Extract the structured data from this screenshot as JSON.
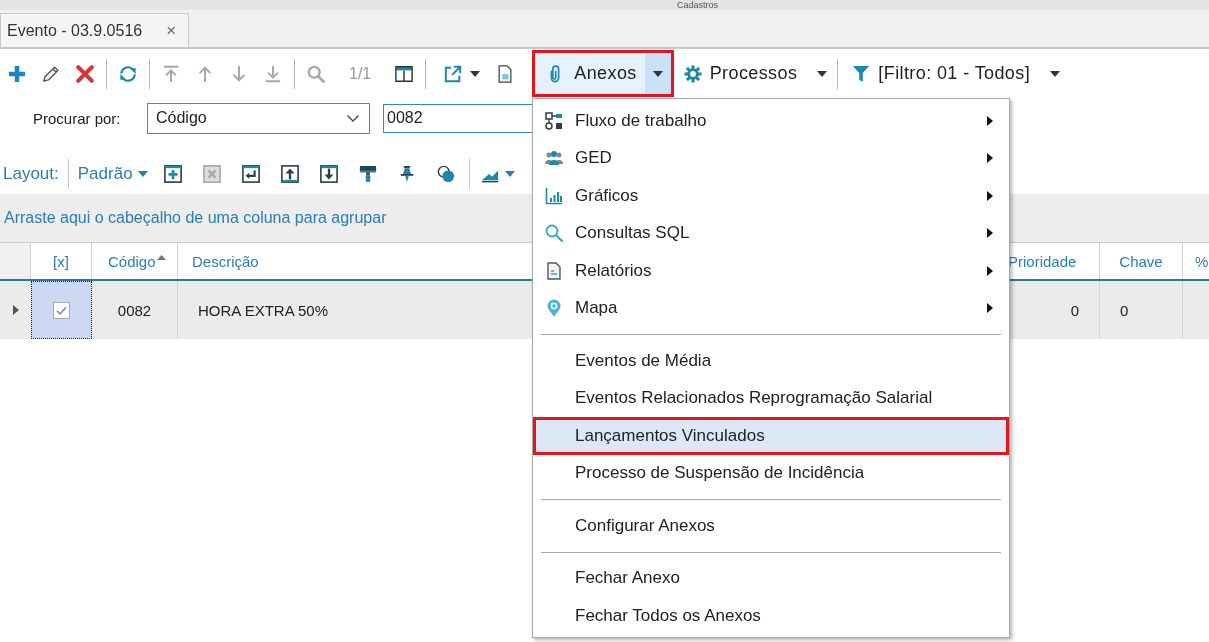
{
  "window": {
    "title": "Cadastros"
  },
  "tabs": [
    {
      "label": "Evento - 03.9.0516",
      "close": "×",
      "selected": true
    }
  ],
  "toolbar": {
    "groups": [
      {
        "items": [
          {
            "kind": "icon_button",
            "disabled": false
          },
          {
            "kind": "icon_button",
            "disabled": false
          },
          {
            "kind": "icon_button",
            "disabled": false
          }
        ]
      },
      {
        "items": [
          {
            "kind": "icon_button",
            "disabled": false
          }
        ]
      },
      {
        "items": [
          {
            "kind": "icon_button",
            "disabled": true
          },
          {
            "kind": "icon_button",
            "disabled": true
          },
          {
            "kind": "icon_button",
            "disabled": true
          },
          {
            "kind": "icon_button",
            "disabled": true
          }
        ]
      },
      {
        "items": [
          {
            "kind": "icon_button",
            "disabled": true
          },
          {
            "kind": "counter",
            "text": "1/1"
          },
          {
            "kind": "icon_button",
            "disabled": false
          }
        ]
      },
      {
        "items": [
          {
            "kind": "icon_dropdown"
          },
          {
            "kind": "icon_button",
            "disabled": false
          },
          {
            "kind": "split_button",
            "label": "Anexos",
            "expanded": true,
            "annotated": true
          },
          {
            "kind": "menu_button",
            "label": "Processos",
            "expanded": false,
            "annotated": false
          }
        ]
      },
      {
        "items": [
          {
            "kind": "menu_button",
            "label": "[Filtro: 01 - Todos]",
            "expanded": false,
            "annotated": false
          }
        ]
      }
    ]
  },
  "search": {
    "label": "Procurar por:",
    "field": {
      "value": "Código"
    },
    "query": {
      "value": "0082",
      "focused": true
    }
  },
  "layout_bar": {
    "label": "Layout:",
    "preset": "Padrão",
    "groups": [
      {
        "items": [
          {
            "kind": "icon_button",
            "disabled": false
          },
          {
            "kind": "icon_button",
            "disabled": true
          },
          {
            "kind": "icon_button",
            "disabled": false
          },
          {
            "kind": "icon_button",
            "disabled": false
          },
          {
            "kind": "icon_button",
            "disabled": false
          },
          {
            "kind": "icon_button",
            "disabled": false
          },
          {
            "kind": "icon_button",
            "disabled": false
          },
          {
            "kind": "icon_button",
            "disabled": false
          }
        ]
      },
      {
        "items": [
          {
            "kind": "icon_dropdown"
          }
        ]
      }
    ]
  },
  "grid": {
    "group_hint": "Arraste aqui o cabeçalho de uma coluna para agrupar",
    "columns": [
      {
        "label": "[x]",
        "sorted": false
      },
      {
        "label": "Código",
        "sorted": true
      },
      {
        "label": "Descrição",
        "sorted": false
      },
      {
        "label": "Prioridade",
        "sorted": false
      },
      {
        "label": "Chave",
        "sorted": false
      },
      {
        "label": "%",
        "sorted": false
      }
    ],
    "rows": [
      {
        "current": true,
        "checked": true,
        "cells": [
          "",
          "0082",
          "HORA EXTRA 50%",
          "0",
          "0"
        ]
      }
    ]
  },
  "menu": {
    "sections": [
      {
        "items": [
          {
            "label": "Fluxo de trabalho",
            "submenu": true,
            "selected": false,
            "annotated": false
          },
          {
            "label": "GED",
            "submenu": true,
            "selected": false,
            "annotated": false
          },
          {
            "label": "Gráficos",
            "submenu": true,
            "selected": false,
            "annotated": false
          },
          {
            "label": "Consultas SQL",
            "submenu": true,
            "selected": false,
            "annotated": false
          },
          {
            "label": "Relatórios",
            "submenu": true,
            "selected": false,
            "annotated": false
          },
          {
            "label": "Mapa",
            "submenu": true,
            "selected": false,
            "annotated": false
          }
        ]
      },
      {
        "items": [
          {
            "label": "Eventos de Média",
            "submenu": false,
            "selected": false,
            "annotated": false
          },
          {
            "label": "Eventos Relacionados Reprogramação Salarial",
            "submenu": false,
            "selected": false,
            "annotated": false
          },
          {
            "label": "Lançamentos Vinculados",
            "submenu": false,
            "selected": true,
            "annotated": true
          },
          {
            "label": "Processo de Suspensão de Incidência",
            "submenu": false,
            "selected": false,
            "annotated": false
          }
        ]
      },
      {
        "items": [
          {
            "label": "Configurar Anexos",
            "submenu": false,
            "selected": false,
            "annotated": false
          }
        ]
      },
      {
        "items": [
          {
            "label": "Fechar Anexo",
            "submenu": false,
            "selected": false,
            "annotated": false
          },
          {
            "label": "Fechar Todos os Anexos",
            "submenu": false,
            "selected": false,
            "annotated": false
          }
        ]
      }
    ]
  }
}
